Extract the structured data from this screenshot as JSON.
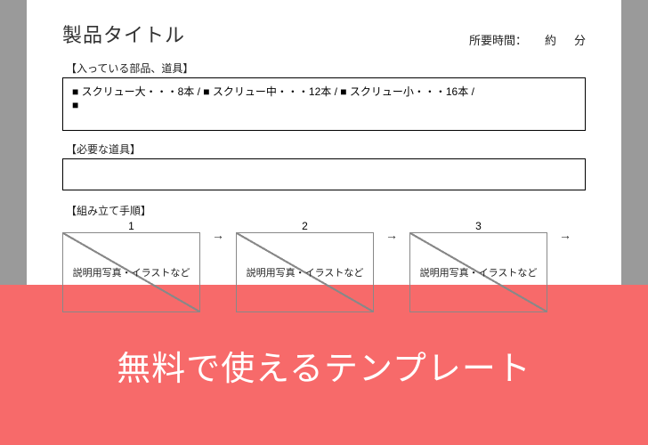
{
  "doc": {
    "title": "製品タイトル",
    "time": {
      "label": "所要時間：",
      "approx": "約",
      "unit": "分"
    },
    "parts": {
      "label": "【入っている部品、道具】",
      "items": [
        {
          "bullet": "■",
          "text": "スクリュー大・・・8本"
        },
        {
          "bullet": "",
          "text": "  /  "
        },
        {
          "bullet": "■",
          "text": "スクリュー中・・・12本"
        },
        {
          "bullet": "",
          "text": "  /  "
        },
        {
          "bullet": "■",
          "text": "スクリュー小・・・16本"
        },
        {
          "bullet": "",
          "text": "  /  "
        }
      ],
      "trailing_bullet": "■"
    },
    "tools": {
      "label": "【必要な道具】"
    },
    "steps": {
      "label": "【組み立て手順】",
      "arrow": "→",
      "numbers": [
        "1",
        "2",
        "3"
      ],
      "placeholder": "説明用写真・イラストなど"
    }
  },
  "banner": {
    "text": "無料で使えるテンプレート"
  }
}
